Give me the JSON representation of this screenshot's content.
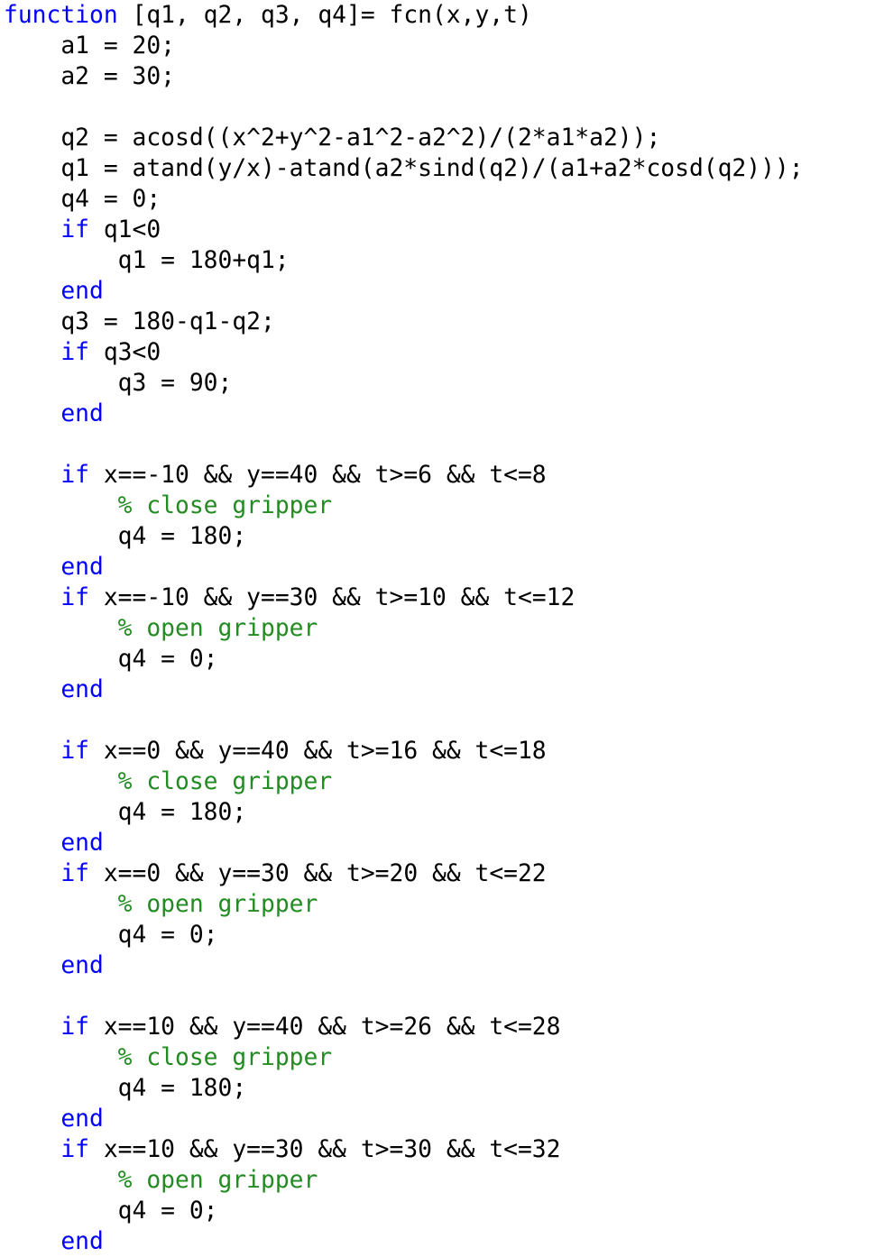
{
  "editor": {
    "colors": {
      "keyword": "#0000ff",
      "comment": "#228b22",
      "text": "#000000",
      "background": "#ffffff"
    },
    "lines": [
      [
        {
          "t": "keyword",
          "v": "function"
        },
        {
          "t": "text",
          "v": " [q1, q2, q3, q4]= fcn(x,y,t)"
        }
      ],
      [
        {
          "t": "text",
          "v": "    a1 = 20;"
        }
      ],
      [
        {
          "t": "text",
          "v": "    a2 = 30;"
        }
      ],
      [],
      [
        {
          "t": "text",
          "v": "    q2 = acosd((x^2+y^2-a1^2-a2^2)/(2*a1*a2));"
        }
      ],
      [
        {
          "t": "text",
          "v": "    q1 = atand(y/x)-atand(a2*sind(q2)/(a1+a2*cosd(q2)));"
        }
      ],
      [
        {
          "t": "text",
          "v": "    q4 = 0;"
        }
      ],
      [
        {
          "t": "text",
          "v": "    "
        },
        {
          "t": "keyword",
          "v": "if"
        },
        {
          "t": "text",
          "v": " q1<0"
        }
      ],
      [
        {
          "t": "text",
          "v": "        q1 = 180+q1;"
        }
      ],
      [
        {
          "t": "text",
          "v": "    "
        },
        {
          "t": "keyword",
          "v": "end"
        }
      ],
      [
        {
          "t": "text",
          "v": "    q3 = 180-q1-q2;"
        }
      ],
      [
        {
          "t": "text",
          "v": "    "
        },
        {
          "t": "keyword",
          "v": "if"
        },
        {
          "t": "text",
          "v": " q3<0"
        }
      ],
      [
        {
          "t": "text",
          "v": "        q3 = 90;"
        }
      ],
      [
        {
          "t": "text",
          "v": "    "
        },
        {
          "t": "keyword",
          "v": "end"
        }
      ],
      [],
      [
        {
          "t": "text",
          "v": "    "
        },
        {
          "t": "keyword",
          "v": "if"
        },
        {
          "t": "text",
          "v": " x==-10 && y==40 && t>=6 && t<=8"
        }
      ],
      [
        {
          "t": "text",
          "v": "        "
        },
        {
          "t": "comment",
          "v": "% close gripper"
        }
      ],
      [
        {
          "t": "text",
          "v": "        q4 = 180;"
        }
      ],
      [
        {
          "t": "text",
          "v": "    "
        },
        {
          "t": "keyword",
          "v": "end"
        }
      ],
      [
        {
          "t": "text",
          "v": "    "
        },
        {
          "t": "keyword",
          "v": "if"
        },
        {
          "t": "text",
          "v": " x==-10 && y==30 && t>=10 && t<=12"
        }
      ],
      [
        {
          "t": "text",
          "v": "        "
        },
        {
          "t": "comment",
          "v": "% open gripper"
        }
      ],
      [
        {
          "t": "text",
          "v": "        q4 = 0;"
        }
      ],
      [
        {
          "t": "text",
          "v": "    "
        },
        {
          "t": "keyword",
          "v": "end"
        }
      ],
      [],
      [
        {
          "t": "text",
          "v": "    "
        },
        {
          "t": "keyword",
          "v": "if"
        },
        {
          "t": "text",
          "v": " x==0 && y==40 && t>=16 && t<=18"
        }
      ],
      [
        {
          "t": "text",
          "v": "        "
        },
        {
          "t": "comment",
          "v": "% close gripper"
        }
      ],
      [
        {
          "t": "text",
          "v": "        q4 = 180;"
        }
      ],
      [
        {
          "t": "text",
          "v": "    "
        },
        {
          "t": "keyword",
          "v": "end"
        }
      ],
      [
        {
          "t": "text",
          "v": "    "
        },
        {
          "t": "keyword",
          "v": "if"
        },
        {
          "t": "text",
          "v": " x==0 && y==30 && t>=20 && t<=22"
        }
      ],
      [
        {
          "t": "text",
          "v": "        "
        },
        {
          "t": "comment",
          "v": "% open gripper"
        }
      ],
      [
        {
          "t": "text",
          "v": "        q4 = 0;"
        }
      ],
      [
        {
          "t": "text",
          "v": "    "
        },
        {
          "t": "keyword",
          "v": "end"
        }
      ],
      [],
      [
        {
          "t": "text",
          "v": "    "
        },
        {
          "t": "keyword",
          "v": "if"
        },
        {
          "t": "text",
          "v": " x==10 && y==40 && t>=26 && t<=28"
        }
      ],
      [
        {
          "t": "text",
          "v": "        "
        },
        {
          "t": "comment",
          "v": "% close gripper"
        }
      ],
      [
        {
          "t": "text",
          "v": "        q4 = 180;"
        }
      ],
      [
        {
          "t": "text",
          "v": "    "
        },
        {
          "t": "keyword",
          "v": "end"
        }
      ],
      [
        {
          "t": "text",
          "v": "    "
        },
        {
          "t": "keyword",
          "v": "if"
        },
        {
          "t": "text",
          "v": " x==10 && y==30 && t>=30 && t<=32"
        }
      ],
      [
        {
          "t": "text",
          "v": "        "
        },
        {
          "t": "comment",
          "v": "% open gripper"
        }
      ],
      [
        {
          "t": "text",
          "v": "        q4 = 0;"
        }
      ],
      [
        {
          "t": "text",
          "v": "    "
        },
        {
          "t": "keyword",
          "v": "end"
        }
      ]
    ]
  }
}
